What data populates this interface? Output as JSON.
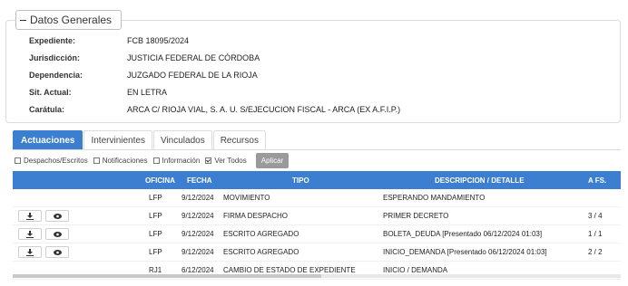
{
  "panel": {
    "title": "Datos Generales",
    "fields": [
      {
        "label": "Expediente:",
        "value": "FCB 18095/2024"
      },
      {
        "label": "Jurisdicción:",
        "value": "JUSTICIA FEDERAL DE CÓRDOBA"
      },
      {
        "label": "Dependencia:",
        "value": "JUZGADO FEDERAL DE LA RIOJA"
      },
      {
        "label": "Sit. Actual:",
        "value": "EN LETRA"
      },
      {
        "label": "Carátula:",
        "value": "ARCA C/ RIOJA VIAL, S. A. U. S/EJECUCION FISCAL - ARCA (EX A.F.I.P.)"
      }
    ]
  },
  "tabs": [
    "Actuaciones",
    "Intervinientes",
    "Vinculados",
    "Recursos"
  ],
  "filters": {
    "items": [
      {
        "label": "Despachos/Escritos",
        "checked": false
      },
      {
        "label": "Notificaciones",
        "checked": false
      },
      {
        "label": "Información",
        "checked": false
      },
      {
        "label": "Ver Todos",
        "checked": true
      }
    ],
    "apply_label": "Aplicar"
  },
  "table": {
    "headers": {
      "oficina": "OFICINA",
      "fecha": "FECHA",
      "tipo": "TIPO",
      "descripcion": "DESCRIPCION / DETALLE",
      "afs": "A FS."
    },
    "rows": [
      {
        "oficina": "LFP",
        "fecha": "9/12/2024",
        "tipo": "MOVIMIENTO",
        "descripcion": "ESPERANDO MANDAMIENTO",
        "afs": "",
        "buttons": false
      },
      {
        "oficina": "LFP",
        "fecha": "9/12/2024",
        "tipo": "FIRMA DESPACHO",
        "descripcion": "PRIMER DECRETO",
        "afs": "3 / 4",
        "buttons": true
      },
      {
        "oficina": "LFP",
        "fecha": "9/12/2024",
        "tipo": "ESCRITO AGREGADO",
        "descripcion": "BOLETA_DEUDA [Presentado 06/12/2024 01:03]",
        "afs": "1 / 1",
        "buttons": true
      },
      {
        "oficina": "LFP",
        "fecha": "9/12/2024",
        "tipo": "ESCRITO AGREGADO",
        "descripcion": "INICIO_DEMANDA [Presentado 06/12/2024 01:03]",
        "afs": "2 / 2",
        "buttons": true
      },
      {
        "oficina": "RJ1",
        "fecha": "6/12/2024",
        "tipo": "CAMBIO DE ESTADO DE EXPEDIENTE",
        "descripcion": "INICIO / DEMANDA",
        "afs": "",
        "buttons": false
      }
    ]
  },
  "icons": {
    "download": "download-icon",
    "view": "eye-icon"
  },
  "colors": {
    "accent": "#3c7fd0",
    "apply_button": "#9a9a9a"
  }
}
